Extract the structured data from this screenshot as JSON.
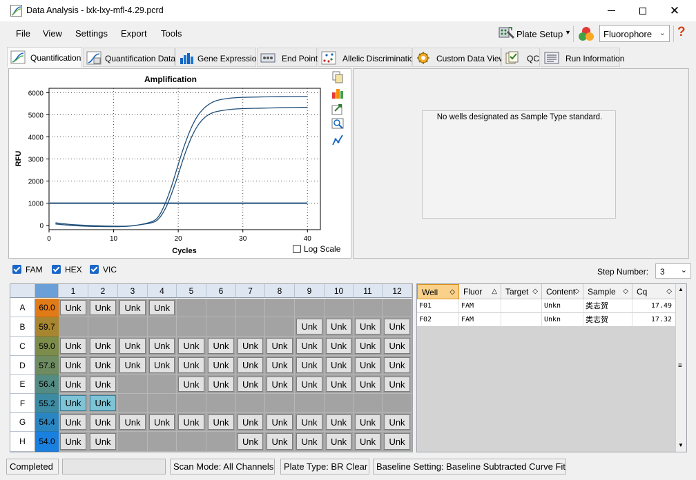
{
  "window": {
    "title": "Data Analysis - lxk-lxy-mfl-4.29.pcrd"
  },
  "menu": {
    "items": [
      "File",
      "View",
      "Settings",
      "Export",
      "Tools"
    ]
  },
  "toolbar": {
    "plate_setup_label": "Plate Setup",
    "fluorophore_value": "Fluorophore",
    "help_symbol": "?"
  },
  "tabs": [
    {
      "label": "Quantification",
      "active": true
    },
    {
      "label": "Quantification Data"
    },
    {
      "label": "Gene Expression"
    },
    {
      "label": "End Point"
    },
    {
      "label": "Allelic Discrimination"
    },
    {
      "label": "Custom Data View"
    },
    {
      "label": "QC"
    },
    {
      "label": "Run Information"
    }
  ],
  "chart_data": {
    "type": "line",
    "title": "Amplification",
    "xlabel": "Cycles",
    "ylabel": "RFU",
    "xlim": [
      0,
      42
    ],
    "ylim": [
      -200,
      6200
    ],
    "xticks": [
      0,
      10,
      20,
      30,
      40
    ],
    "yticks": [
      0,
      1000,
      2000,
      3000,
      4000,
      5000,
      6000
    ],
    "grid": true,
    "threshold": 1000,
    "series": [
      {
        "x": [
          1,
          4,
          8,
          12,
          14,
          16,
          17,
          18,
          19,
          20,
          21,
          22,
          23,
          24,
          25,
          26,
          28,
          30,
          33,
          36,
          40
        ],
        "y": [
          60,
          -20,
          -60,
          -50,
          20,
          170,
          420,
          1000,
          1800,
          2750,
          3650,
          4400,
          4950,
          5300,
          5520,
          5650,
          5750,
          5790,
          5810,
          5820,
          5830
        ]
      },
      {
        "x": [
          1,
          4,
          8,
          12,
          14,
          16,
          17,
          18,
          19,
          20,
          21,
          22,
          23,
          24,
          25,
          26,
          28,
          30,
          33,
          36,
          40
        ],
        "y": [
          110,
          20,
          -30,
          -40,
          20,
          120,
          300,
          750,
          1450,
          2300,
          3200,
          3950,
          4500,
          4850,
          5050,
          5150,
          5240,
          5280,
          5300,
          5320,
          5340
        ]
      }
    ],
    "log_scale_label": "Log Scale",
    "log_scale_checked": false
  },
  "standards_message": "No wells designated as Sample Type standard.",
  "fluors": [
    {
      "label": "FAM",
      "checked": true
    },
    {
      "label": "HEX",
      "checked": true
    },
    {
      "label": "VIC",
      "checked": true
    }
  ],
  "step": {
    "label": "Step Number:",
    "value": "3"
  },
  "plate": {
    "columns": [
      "1",
      "2",
      "3",
      "4",
      "5",
      "6",
      "7",
      "8",
      "9",
      "10",
      "11",
      "12"
    ],
    "rows": [
      {
        "label": "A",
        "temp": "60.0",
        "color": "#e07b18",
        "wells": [
          1,
          1,
          1,
          1,
          0,
          0,
          0,
          0,
          0,
          0,
          0,
          0
        ]
      },
      {
        "label": "B",
        "temp": "59.7",
        "color": "#a8852f",
        "wells": [
          0,
          0,
          0,
          0,
          0,
          0,
          0,
          0,
          1,
          1,
          1,
          1
        ]
      },
      {
        "label": "C",
        "temp": "59.0",
        "color": "#7c8c4a",
        "wells": [
          1,
          1,
          1,
          1,
          1,
          1,
          1,
          1,
          1,
          1,
          1,
          1
        ]
      },
      {
        "label": "D",
        "temp": "57.8",
        "color": "#6e8b62",
        "wells": [
          1,
          1,
          1,
          1,
          1,
          1,
          1,
          1,
          1,
          1,
          1,
          1
        ]
      },
      {
        "label": "E",
        "temp": "56.4",
        "color": "#548b82",
        "wells": [
          1,
          1,
          0,
          0,
          1,
          1,
          1,
          1,
          1,
          1,
          1,
          1
        ]
      },
      {
        "label": "F",
        "temp": "55.2",
        "color": "#3d8aa3",
        "wells": [
          2,
          2,
          0,
          0,
          0,
          0,
          0,
          0,
          0,
          0,
          0,
          0
        ]
      },
      {
        "label": "G",
        "temp": "54.4",
        "color": "#2a86c2",
        "wells": [
          1,
          1,
          1,
          1,
          1,
          1,
          1,
          1,
          1,
          1,
          1,
          1
        ]
      },
      {
        "label": "H",
        "temp": "54.0",
        "color": "#1a80e0",
        "wells": [
          1,
          1,
          0,
          0,
          0,
          0,
          1,
          1,
          1,
          1,
          1,
          1
        ]
      }
    ],
    "well_label": "Unk"
  },
  "well_table": {
    "headers": [
      "Well",
      "Fluor",
      "Target",
      "Content",
      "Sample",
      "Cq"
    ],
    "rows": [
      [
        "F01",
        "FAM",
        "",
        "Unkn",
        "类志贺",
        "17.49"
      ],
      [
        "F02",
        "FAM",
        "",
        "Unkn",
        "类志贺",
        "17.32"
      ]
    ]
  },
  "status": {
    "state": "Completed",
    "scan_mode": "Scan Mode: All Channels",
    "plate_type": "Plate Type: BR Clear",
    "baseline": "Baseline Setting: Baseline Subtracted Curve Fit"
  }
}
